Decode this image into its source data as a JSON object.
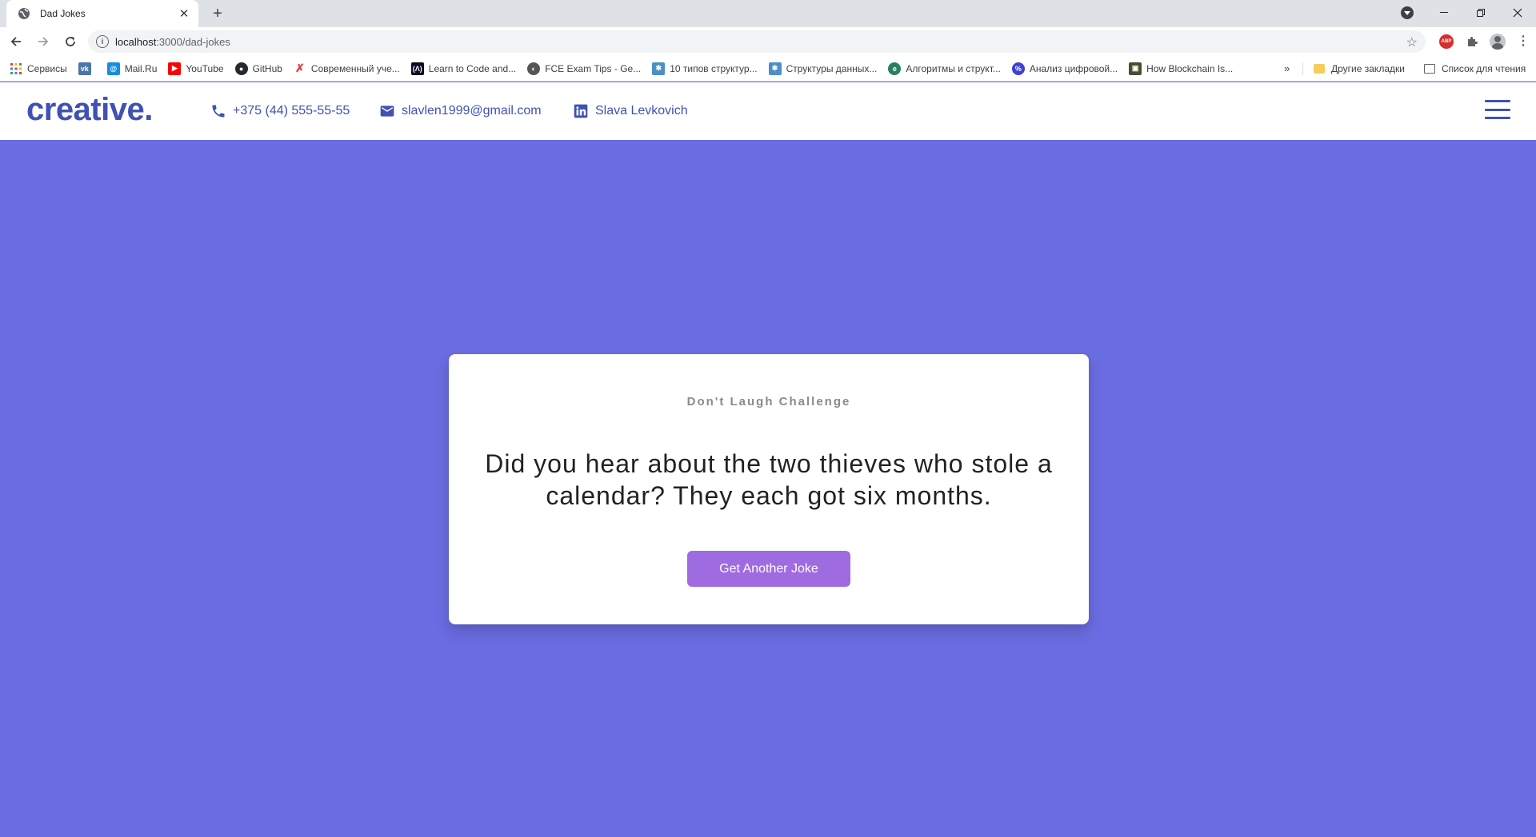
{
  "browser": {
    "tab_title": "Dad Jokes",
    "url_host": "localhost",
    "url_path": ":3000/dad-jokes",
    "bookmarks": [
      {
        "label": "Сервисы",
        "icon": "apps-icon",
        "color": "#e94235"
      },
      {
        "label": "",
        "icon": "vk-icon",
        "color": "#4a76a8"
      },
      {
        "label": "Mail.Ru",
        "icon": "mailru-icon",
        "color": "#168de2"
      },
      {
        "label": "YouTube",
        "icon": "youtube-icon",
        "color": "#ff0000"
      },
      {
        "label": "GitHub",
        "icon": "github-icon",
        "color": "#24292e"
      },
      {
        "label": "Современный уче...",
        "icon": "bookmark-icon",
        "color": "#e53935"
      },
      {
        "label": "Learn to Code and...",
        "icon": "freecodecamp-icon",
        "color": "#0a0a23"
      },
      {
        "label": "FCE Exam Tips - Ge...",
        "icon": "bookmark-icon",
        "color": "#555555"
      },
      {
        "label": "10 типов структур...",
        "icon": "bookmark-icon",
        "color": "#4a90c8"
      },
      {
        "label": "Структуры данных...",
        "icon": "bookmark-icon",
        "color": "#4a90c8"
      },
      {
        "label": "Алгоритмы и структ...",
        "icon": "bookmark-icon",
        "color": "#2a7f62"
      },
      {
        "label": "Анализ цифровой...",
        "icon": "bookmark-icon",
        "color": "#3f3fd4"
      },
      {
        "label": "How Blockchain Is...",
        "icon": "bookmark-icon",
        "color": "#4d4d2e"
      }
    ],
    "other_bookmarks": "Другие закладки",
    "reading_list": "Список для чтения"
  },
  "header": {
    "logo": "creative.",
    "phone": "+375 (44) 555-55-55",
    "email": "slavlen1999@gmail.com",
    "linkedin": "Slava Levkovich"
  },
  "card": {
    "heading": "Don't Laugh Challenge",
    "joke": "Did you hear about the two thieves who stole a calendar? They each got six months.",
    "button_label": "Get Another Joke"
  },
  "colors": {
    "page_background": "#6a6ce1",
    "brand": "#3f51b5",
    "button": "#9f6be0"
  }
}
